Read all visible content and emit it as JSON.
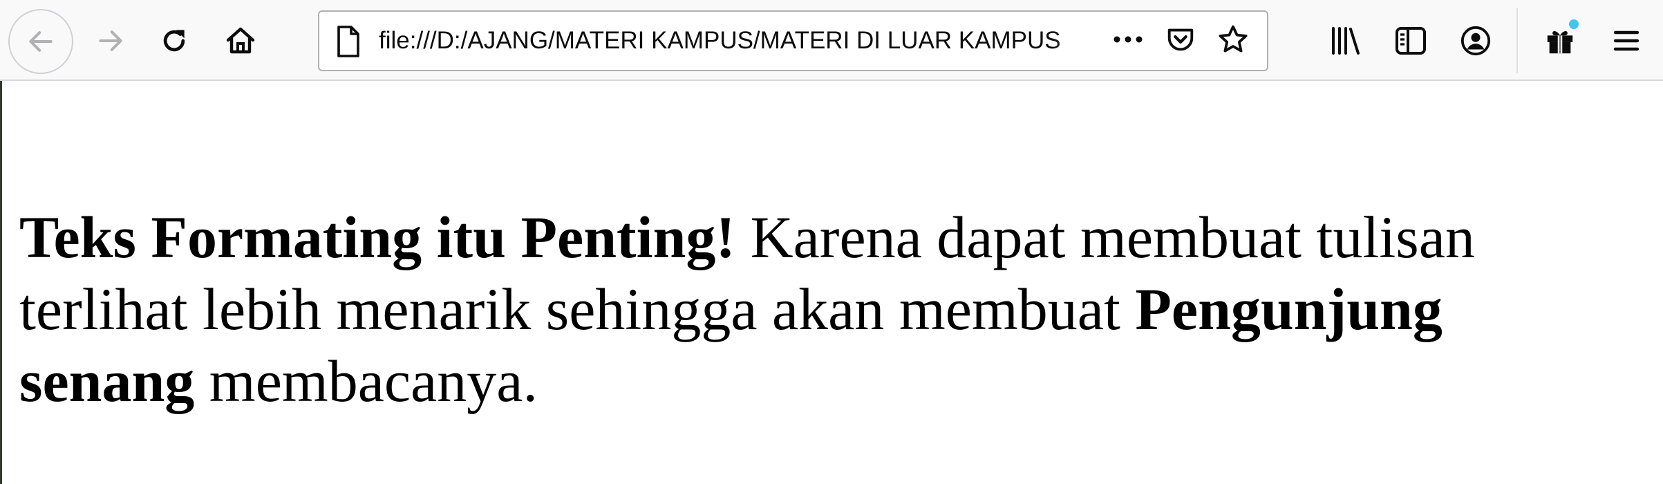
{
  "browser": {
    "url": "file:///D:/AJANG/MATERI KAMPUS/MATERI DI LUAR KAMPUS",
    "icons": {
      "back": "arrow-left-icon",
      "forward": "arrow-right-icon",
      "reload": "reload-icon",
      "home": "home-icon",
      "page": "page-icon",
      "more": "ellipsis-icon",
      "pocket": "pocket-icon",
      "bookmark": "star-icon",
      "library": "library-icon",
      "sidebar": "sidebar-icon",
      "account": "account-icon",
      "whats_new": "gift-icon",
      "menu": "hamburger-icon"
    },
    "notification_dot_color": "#45c4ee"
  },
  "page": {
    "segments": [
      {
        "text": "Teks Formating itu Penting!",
        "bold": true
      },
      {
        "text": " Karena dapat membuat tulisan terlihat lebih menarik sehingga akan membuat ",
        "bold": false
      },
      {
        "text": "Pengunjung senang",
        "bold": true
      },
      {
        "text": " membacanya.",
        "bold": false
      }
    ]
  }
}
